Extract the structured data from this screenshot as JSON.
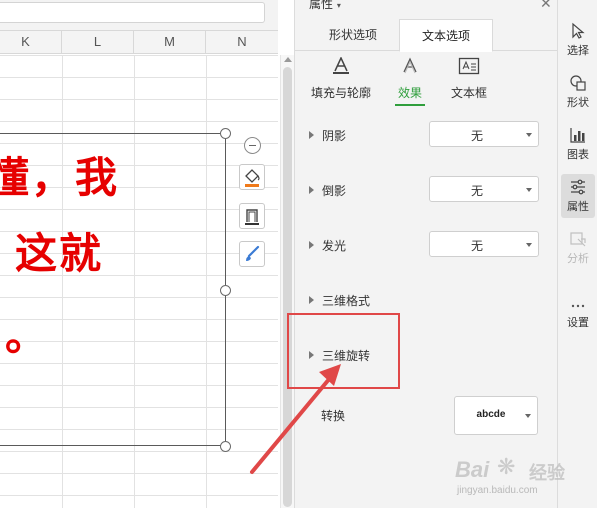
{
  "sheet": {
    "columns": [
      "K",
      "L",
      "M",
      "N"
    ],
    "textbox_lines": [
      "懂，我",
      "，这就",
      "。"
    ]
  },
  "panel": {
    "title": "属性",
    "tabs": [
      {
        "label": "形状选项",
        "active": false
      },
      {
        "label": "文本选项",
        "active": true
      }
    ],
    "subtabs": [
      {
        "label": "填充与轮廓",
        "icon": "text-fill-icon",
        "active": false
      },
      {
        "label": "效果",
        "icon": "text-effect-icon",
        "active": true
      },
      {
        "label": "文本框",
        "icon": "textbox-icon",
        "active": false
      }
    ],
    "sections": [
      {
        "label": "阴影",
        "value": "无"
      },
      {
        "label": "倒影",
        "value": "无"
      },
      {
        "label": "发光",
        "value": "无"
      },
      {
        "label": "三维格式"
      },
      {
        "label": "三维旋转",
        "highlighted": true
      }
    ],
    "transform": {
      "label": "转换",
      "value": "abcde"
    }
  },
  "right_toolbar": [
    {
      "label": "选择",
      "icon": "cursor-icon",
      "active": false,
      "disabled": false
    },
    {
      "label": "形状",
      "icon": "shapes-icon",
      "active": false,
      "disabled": false
    },
    {
      "label": "图表",
      "icon": "chart-icon",
      "active": false,
      "disabled": false
    },
    {
      "label": "属性",
      "icon": "sliders-icon",
      "active": true,
      "disabled": false
    },
    {
      "label": "分析",
      "icon": "analysis-icon",
      "active": false,
      "disabled": true
    },
    {
      "label": "设置",
      "icon": "more-icon",
      "active": false,
      "disabled": false
    }
  ],
  "watermark": {
    "logo": "Bai",
    "logo_text": "经验",
    "url": "jingyan.baidu.com"
  },
  "colors": {
    "accent": "#2f9e3c",
    "highlight": "#e04848",
    "textbox_text": "#e60000"
  }
}
